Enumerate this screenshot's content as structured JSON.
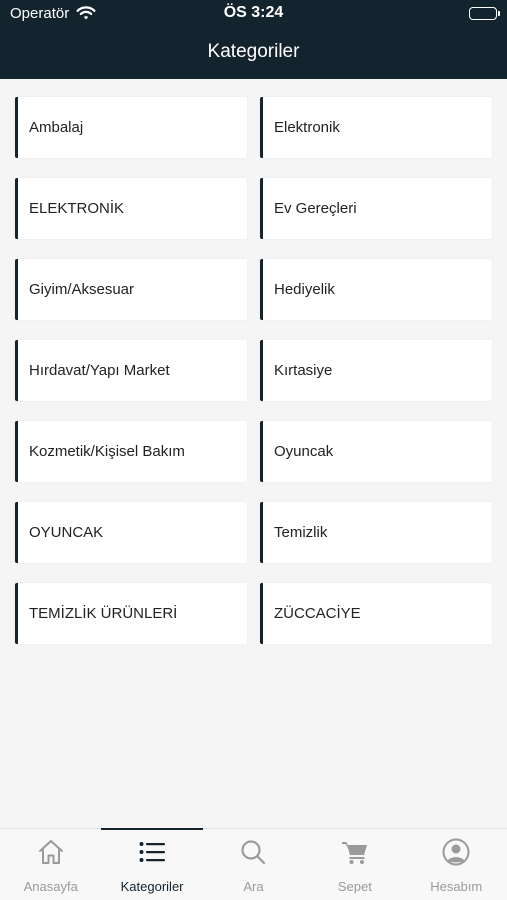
{
  "status_bar": {
    "carrier": "Operatör",
    "time": "ÖS 3:24"
  },
  "header": {
    "title": "Kategoriler"
  },
  "categories": [
    {
      "label": "Ambalaj"
    },
    {
      "label": "Elektronik"
    },
    {
      "label": "ELEKTRONİK"
    },
    {
      "label": "Ev Gereçleri"
    },
    {
      "label": "Giyim/Aksesuar"
    },
    {
      "label": "Hediyelik"
    },
    {
      "label": "Hırdavat/Yapı Market"
    },
    {
      "label": "Kırtasiye"
    },
    {
      "label": "Kozmetik/Kişisel Bakım"
    },
    {
      "label": "Oyuncak"
    },
    {
      "label": "OYUNCAK"
    },
    {
      "label": "Temizlik"
    },
    {
      "label": "TEMİZLİK ÜRÜNLERİ"
    },
    {
      "label": "ZÜCCACİYE"
    }
  ],
  "tab_bar": {
    "tabs": [
      {
        "label": "Anasayfa",
        "icon": "home-icon"
      },
      {
        "label": "Kategoriler",
        "icon": "list-icon",
        "active": true
      },
      {
        "label": "Ara",
        "icon": "search-icon"
      },
      {
        "label": "Sepet",
        "icon": "cart-icon"
      },
      {
        "label": "Hesabım",
        "icon": "account-icon"
      }
    ]
  },
  "colors": {
    "primary": "#13242f",
    "background": "#f5f5f5",
    "card": "#ffffff",
    "tab_inactive": "#9a9a9a"
  }
}
